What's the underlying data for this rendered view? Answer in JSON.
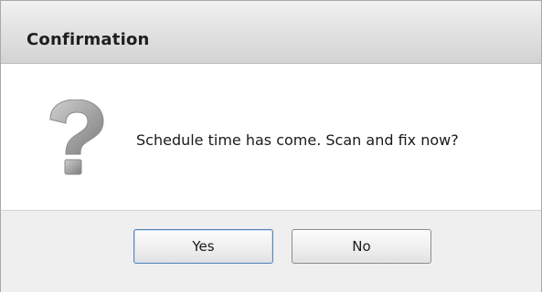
{
  "dialog": {
    "title": "Confirmation",
    "icon": "question-mark-icon",
    "message": "Schedule time has come. Scan and fix now?",
    "buttons": {
      "yes_label": "Yes",
      "no_label": "No"
    }
  },
  "colors": {
    "titlebar": "#e3e3e3",
    "footer": "#efefef",
    "default_button_border": "#5b84b5",
    "icon_gray": "#9a9a9a"
  }
}
